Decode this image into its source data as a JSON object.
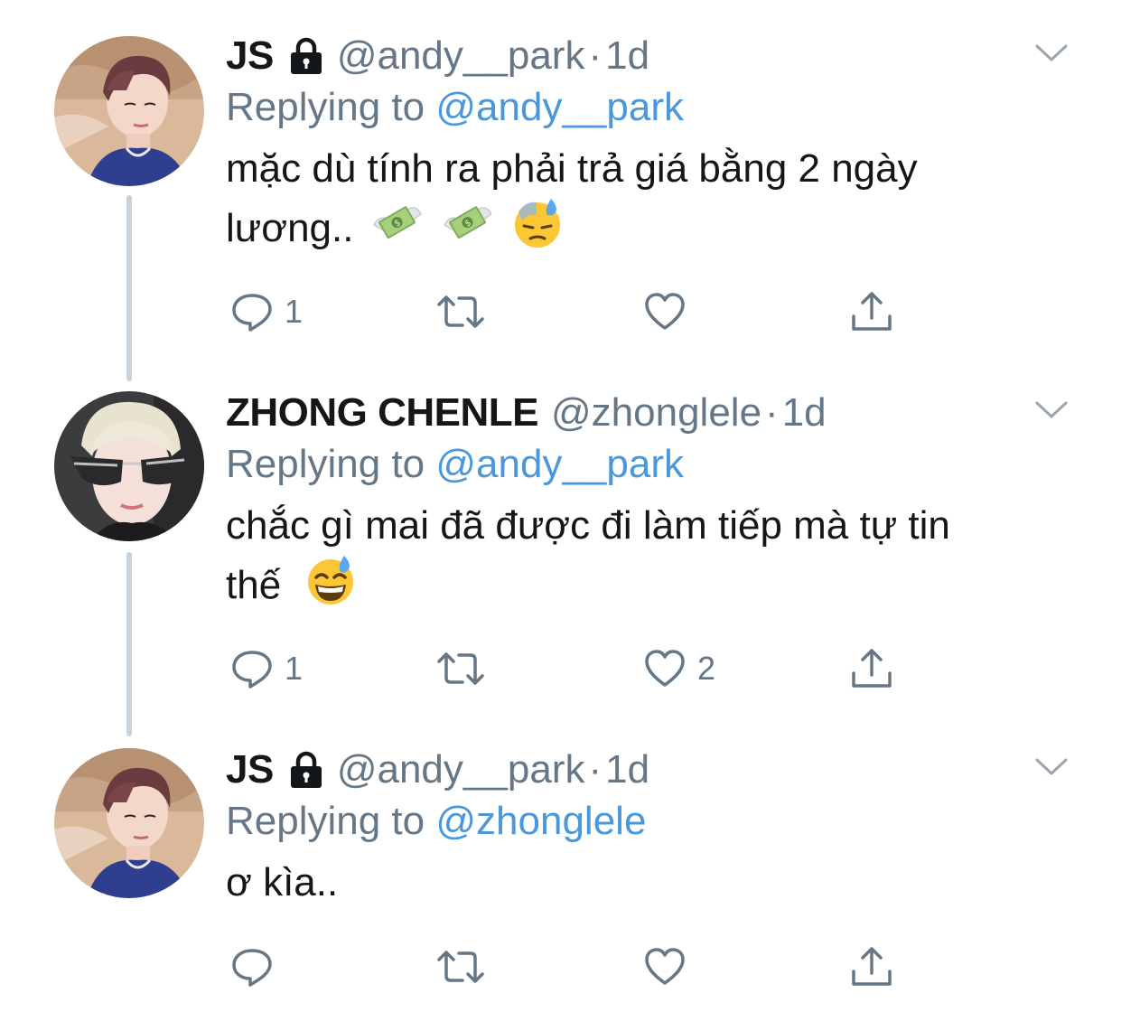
{
  "tweets": [
    {
      "name": "JS",
      "locked": true,
      "handle": "@andy__park",
      "separator": "·",
      "time": "1d",
      "replying_prefix": "Replying to",
      "replying_to": "@andy__park",
      "text_line1": "mặc dù tính ra phải trả giá bằng 2 ngày",
      "text_line2": "lương..",
      "emojis": [
        "money-with-wings",
        "money-with-wings",
        "sweat-face"
      ],
      "reply_count": "1",
      "retweet_count": "",
      "like_count": ""
    },
    {
      "name": "ZHONG CHENLE",
      "locked": false,
      "handle": "@zhonglele",
      "separator": "·",
      "time": "1d",
      "replying_prefix": "Replying to",
      "replying_to": "@andy__park",
      "text_line1": "chắc gì mai đã được đi làm tiếp mà tự tin",
      "text_line2": "thế",
      "emojis": [
        "grinning-sweat-face"
      ],
      "reply_count": "1",
      "retweet_count": "",
      "like_count": "2"
    },
    {
      "name": "JS",
      "locked": true,
      "handle": "@andy__park",
      "separator": "·",
      "time": "1d",
      "replying_prefix": "Replying to",
      "replying_to": "@zhonglele",
      "text_line1": "ơ kìa..",
      "text_line2": "",
      "emojis": [],
      "reply_count": "",
      "retweet_count": "",
      "like_count": ""
    }
  ],
  "colors": {
    "primary_text": "#14171a",
    "secondary_text": "#657786",
    "link": "#4a98db",
    "thread_line": "#c7d3dc",
    "icon": "#657786"
  },
  "icons": {
    "reply": "reply-icon",
    "retweet": "retweet-icon",
    "like": "heart-icon",
    "share": "share-icon",
    "more": "chevron-down-icon",
    "lock": "lock-icon"
  }
}
